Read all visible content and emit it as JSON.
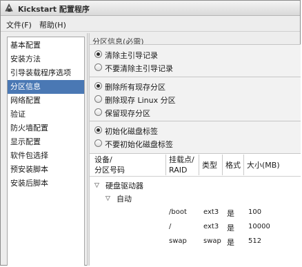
{
  "window": {
    "title": "Kickstart 配置程序"
  },
  "menu": [
    {
      "label": "文件(F)"
    },
    {
      "label": "帮助(H)"
    }
  ],
  "sidebar": {
    "items": [
      {
        "label": "基本配置"
      },
      {
        "label": "安装方法"
      },
      {
        "label": "引导装载程序选项"
      },
      {
        "label": "分区信息",
        "selected": true
      },
      {
        "label": "网络配置"
      },
      {
        "label": "验证"
      },
      {
        "label": "防火墙配置"
      },
      {
        "label": "显示配置"
      },
      {
        "label": "软件包选择"
      },
      {
        "label": "预安装脚本"
      },
      {
        "label": "安装后脚本"
      }
    ]
  },
  "partition": {
    "heading": "分区信息(必需)",
    "mbr_group": {
      "options": [
        {
          "label": "清除主引导记录",
          "selected": true
        },
        {
          "label": "不要清除主引导记录",
          "selected": false
        }
      ]
    },
    "clear_group": {
      "options": [
        {
          "label": "删除所有现存分区",
          "selected": true
        },
        {
          "label": "删除现存 Linux 分区",
          "selected": false
        },
        {
          "label": "保留现存分区",
          "selected": false
        }
      ]
    },
    "label_group": {
      "options": [
        {
          "label": "初始化磁盘标签",
          "selected": true
        },
        {
          "label": "不要初始化磁盘标签",
          "selected": false
        }
      ]
    },
    "table": {
      "headers": {
        "device_line1": "设备/",
        "device_line2": "分区号码",
        "mount_line1": "挂载点/",
        "mount_line2": "RAID",
        "type": "类型",
        "format": "格式",
        "size": "大小(MB)"
      },
      "tree": {
        "root": "硬盘驱动器",
        "child": "自动"
      },
      "rows": [
        {
          "mount": "/boot",
          "type": "ext3",
          "format": "是",
          "size": "100"
        },
        {
          "mount": "/",
          "type": "ext3",
          "format": "是",
          "size": "10000"
        },
        {
          "mount": "swap",
          "type": "swap",
          "format": "是",
          "size": "512"
        }
      ]
    }
  }
}
